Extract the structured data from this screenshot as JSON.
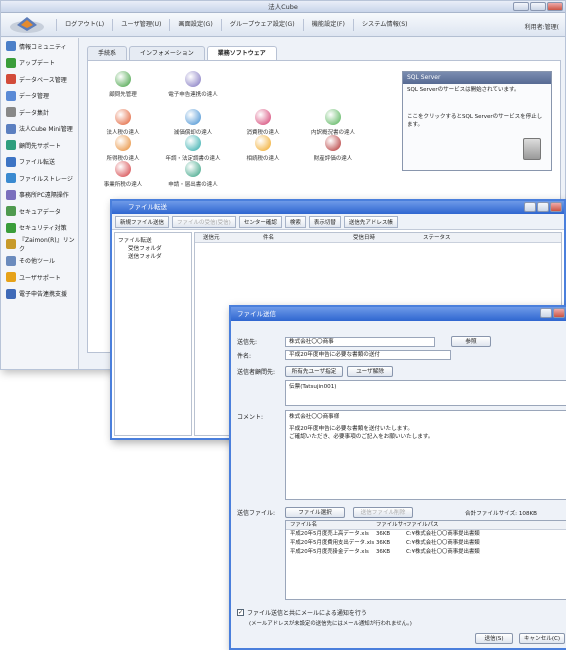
{
  "main": {
    "title": "法人Cube",
    "menus": [
      "ログアウト(L)",
      "ユーザ管理(U)",
      "画面設定(G)",
      "グループウェア設定(G)",
      "機能設定(F)",
      "システム情報(S)"
    ],
    "user": "利用者:管理("
  },
  "sidebar": {
    "items": [
      "情報コミュニティ",
      "アップデート",
      "データベース管理",
      "データ管理",
      "データ集計",
      "法人Cube Mini管理",
      "顧問先サポート",
      "ファイル転送",
      "ファイルストレージ",
      "事務所PC遠隔操作",
      "セキュアデータ",
      "セキュリティ対策",
      "『Zaimon(R)』リンク",
      "その他ツール",
      "ユーザサポート",
      "電子申告連携支援"
    ]
  },
  "tabs": [
    "手続系",
    "インフォメーション",
    "業務ソフトウェア"
  ],
  "apps": [
    "顧問先管理",
    "電子申告連携の達人",
    "法人税の達人",
    "減価償却の達人",
    "消費税の達人",
    "内訳概況書の達人",
    "所得税の達人",
    "年調・法定調書の達人",
    "相続税の達人",
    "財産評価の達人",
    "事業所税の達人",
    "申請・届出書の達人"
  ],
  "sql": {
    "header": "SQL Server",
    "msg1": "SQL Serverのサービスは開始されています。",
    "msg2": "ここをクリックするとSQL Serverのサービスを停止します。"
  },
  "transfer": {
    "title": "ファイル転送",
    "tools": [
      "新規ファイル送信",
      "ファイルの受信(受信)",
      "センター確認",
      "検索",
      "表示切替",
      "送信先アドレス帳"
    ],
    "tree": [
      "ファイル転送",
      "受信フォルダ",
      "送信フォルダ"
    ],
    "cols": [
      "送信元",
      "件名",
      "受信日時",
      "ステータス"
    ]
  },
  "send": {
    "title": "ファイル送信",
    "to_label": "送信先:",
    "to": "株式会社〇〇商事",
    "ref": "参照",
    "subj_label": "件名:",
    "subj": "平成20年度申告に必要な書類の送付",
    "mgr_label": "送信者顧問先:",
    "btn_mgr": "所有先ユーザ指定",
    "btn_usr": "ユーザ解除",
    "mgr_entry": "伝票(Tatsujin001)",
    "comment_label": "コメント:",
    "comment": [
      "株式会社〇〇商事様",
      "平成20年度申告に必要な書類を送付いたします。",
      "ご確認いただき、必要事項のご記入をお願いいたします。"
    ],
    "files_label": "送信ファイル:",
    "btn_sel": "ファイル選択",
    "btn_del": "送信ファイル削除",
    "total": "合計ファイルサイズ: 108KB",
    "fcols": [
      "ファイル名",
      "ファイルサイ",
      "ファイルパス"
    ],
    "files": [
      [
        "平成20年5月度売上高データ.xls",
        "36KB",
        "C:¥株式会社〇〇商事提出書類"
      ],
      [
        "平成20年5月度費用支出データ.xls",
        "36KB",
        "C:¥株式会社〇〇商事提出書類"
      ],
      [
        "平成20年5月度売掛金データ.xls",
        "36KB",
        "C:¥株式会社〇〇商事提出書類"
      ]
    ],
    "mail": "ファイル送信と共にメールによる通知を行う",
    "note": "(メールアドレスが未設定の送信先にはメール通知が行われません。)",
    "btn_send": "送信(S)",
    "btn_cancel": "キャンセル(C)"
  }
}
